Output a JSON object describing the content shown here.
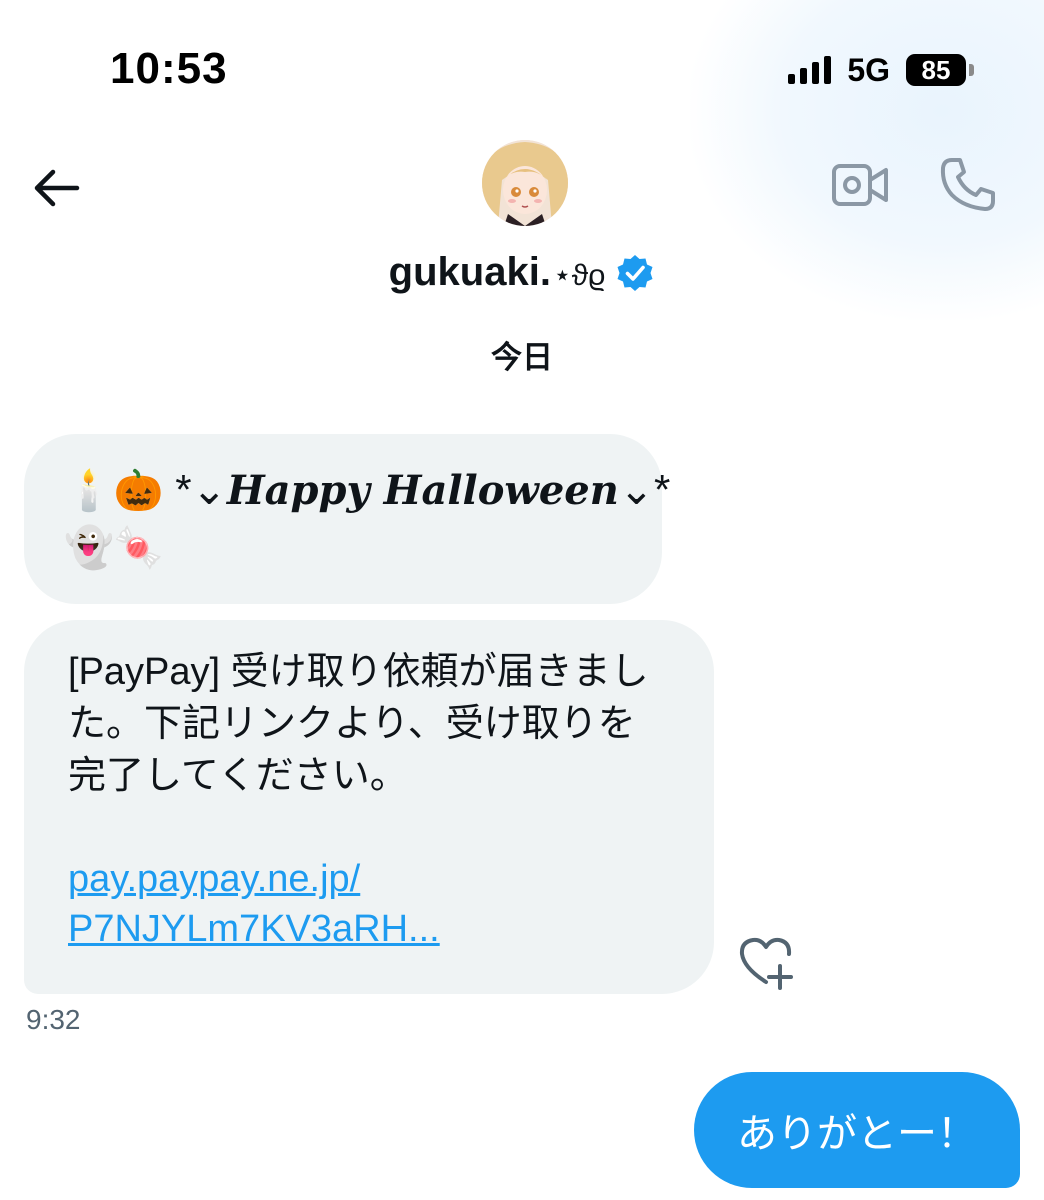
{
  "status_bar": {
    "time": "10:53",
    "network": "5G",
    "battery": "85"
  },
  "header": {
    "display_name": "gukuaki.",
    "name_decoration": "⋆ϑϱ",
    "verified": true,
    "verified_color": "#1d9bf0",
    "back_icon": "arrow-left-icon",
    "video_icon": "video-camera-icon",
    "phone_icon": "phone-icon"
  },
  "conversation": {
    "date_label": "今日",
    "messages": [
      {
        "direction": "incoming",
        "emoji_lead": "🕯️🎃",
        "text": "*𝓗𝓪𝓹𝓹𝔂 𝓗𝓪𝓵𝓵𝓸𝔀𝓮𝓮𝓷*",
        "text_plain": "Happy Halloween",
        "deco_left": "*⌄",
        "deco_right": "⌄*",
        "emoji_tail": "👻🍬"
      },
      {
        "direction": "incoming",
        "text": "[PayPay] 受け取り依頼が届きました。下記リンクより、受け取りを完了してください。",
        "link": "pay.paypay.ne.jp/\nP7NJYLm7KV3aRH...",
        "time": "9:32"
      },
      {
        "direction": "outgoing",
        "text": "ありがとー！"
      }
    ]
  },
  "colors": {
    "incoming_bubble": "#eff3f4",
    "outgoing_bubble": "#1d9bf0",
    "link": "#1d9bf0",
    "icon_gray": "#8b98a5"
  }
}
